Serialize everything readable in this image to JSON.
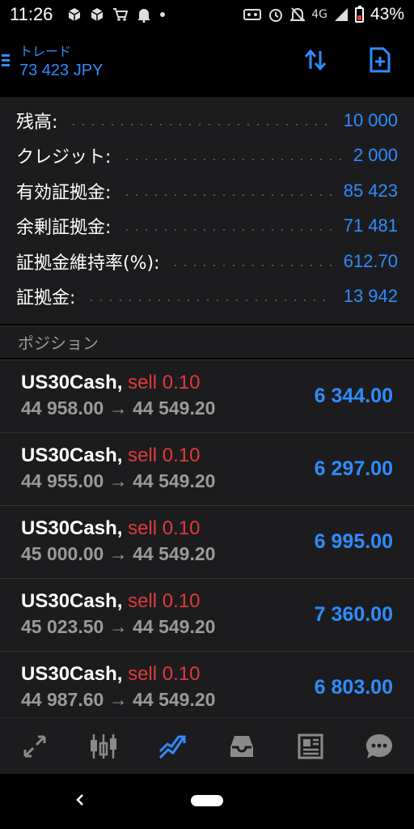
{
  "status_bar": {
    "time": "11:26",
    "network": "4G",
    "battery": "43%",
    "left_icons": [
      "box-icon",
      "box-icon",
      "cart-icon",
      "bell-icon",
      "dot-icon"
    ],
    "right_icons": [
      "voicemail-icon",
      "alarm-icon",
      "mute-icon",
      "signal-icon",
      "battery-icon"
    ]
  },
  "header": {
    "title": "トレード",
    "subtitle": "73 423 JPY",
    "actions": [
      "sort-icon",
      "new-order-icon"
    ]
  },
  "summary": [
    {
      "label": "残高:",
      "value": "10 000"
    },
    {
      "label": "クレジット:",
      "value": "2 000"
    },
    {
      "label": "有効証拠金:",
      "value": "85 423"
    },
    {
      "label": "余剰証拠金:",
      "value": "71 481"
    },
    {
      "label": "証拠金維持率(%):",
      "value": "612.70"
    },
    {
      "label": "証拠金:",
      "value": "13 942"
    }
  ],
  "positions_section": {
    "title": "ポジション"
  },
  "positions": [
    {
      "symbol": "US30Cash,",
      "side": "sell 0.10",
      "prices": "44 958.00 → 44 549.20",
      "profit": "6 344.00"
    },
    {
      "symbol": "US30Cash,",
      "side": "sell 0.10",
      "prices": "44 955.00 → 44 549.20",
      "profit": "6 297.00"
    },
    {
      "symbol": "US30Cash,",
      "side": "sell 0.10",
      "prices": "45 000.00 → 44 549.20",
      "profit": "6 995.00"
    },
    {
      "symbol": "US30Cash,",
      "side": "sell 0.10",
      "prices": "45 023.50 → 44 549.20",
      "profit": "7 360.00"
    },
    {
      "symbol": "US30Cash,",
      "side": "sell 0.10",
      "prices": "44 987.60 → 44 549.20",
      "profit": "6 803.00"
    }
  ],
  "bottom_nav": [
    {
      "icon": "quotes-icon",
      "active": false
    },
    {
      "icon": "chart-icon",
      "active": false
    },
    {
      "icon": "trade-icon",
      "active": true
    },
    {
      "icon": "history-icon",
      "active": false
    },
    {
      "icon": "news-icon",
      "active": false
    },
    {
      "icon": "chat-icon",
      "active": false
    }
  ],
  "colors": {
    "accent": "#2f8cff",
    "sell": "#e03a3a",
    "panel": "#1c1c1e",
    "muted": "#9a9a9a"
  }
}
